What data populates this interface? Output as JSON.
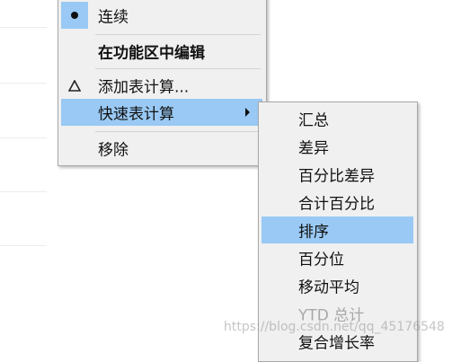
{
  "main_menu": {
    "items": [
      {
        "label": "连续",
        "icon": "bullet-dot"
      },
      {
        "label": "在功能区中编辑"
      },
      {
        "label": "添加表计算...",
        "icon": "delta-icon"
      },
      {
        "label": "快速表计算",
        "has_submenu": true,
        "highlighted": true
      },
      {
        "label": "移除"
      }
    ]
  },
  "submenu": {
    "items": [
      {
        "label": "汇总"
      },
      {
        "label": "差异"
      },
      {
        "label": "百分比差异"
      },
      {
        "label": "合计百分比"
      },
      {
        "label": "排序",
        "highlighted": true
      },
      {
        "label": "百分位"
      },
      {
        "label": "移动平均"
      },
      {
        "label": "YTD 总计",
        "disabled": true
      },
      {
        "label": "复合增长率"
      }
    ]
  },
  "watermark": "https://blog.csdn.net/qq_45176548",
  "colors": {
    "menu_bg": "#f0f0f0",
    "highlight": "#99c9f4",
    "border": "#a7a7a7",
    "disabled_text": "#a8a8a8"
  }
}
